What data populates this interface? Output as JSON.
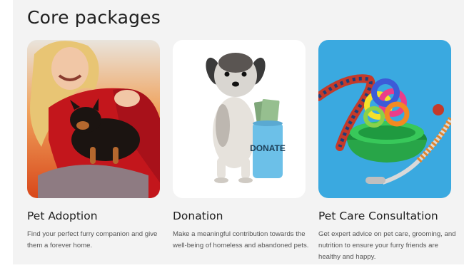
{
  "section": {
    "title": "Core packages"
  },
  "packages": [
    {
      "title": "Pet Adoption",
      "description": "Find your perfect furry companion and give them a forever home.",
      "image_subject": "woman-holding-puppy"
    },
    {
      "title": "Donation",
      "description": "Make a meaningful contribution towards the well-being of homeless and abandoned pets.",
      "image_subject": "dog-with-donation-jar",
      "image_text": "DONATE"
    },
    {
      "title": "Pet Care Consultation",
      "description": "Get expert advice on pet care, grooming, and nutrition to ensure your furry friends are healthy and happy.",
      "image_subject": "pet-bowl-toy-leash"
    }
  ],
  "colors": {
    "section_bg": "#f3f3f3",
    "adoption_bg": "#e2561c",
    "consultation_bg": "#3aa9e0"
  }
}
